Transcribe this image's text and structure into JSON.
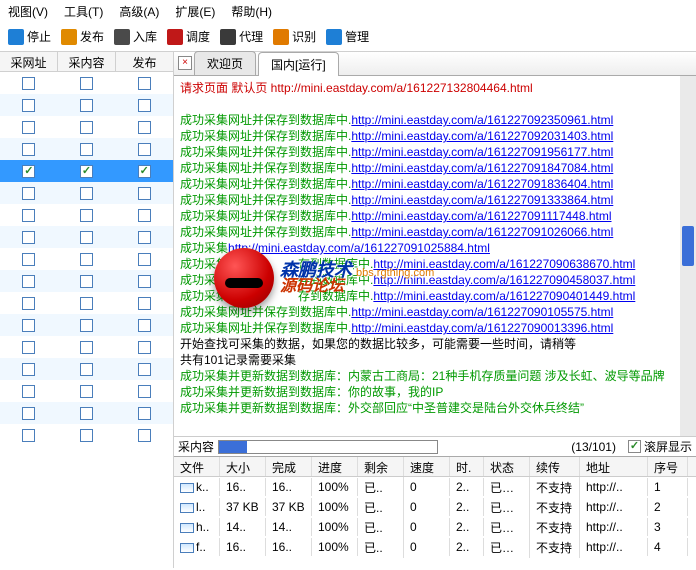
{
  "menu": [
    "视图(V)",
    "工具(T)",
    "高级(A)",
    "扩展(E)",
    "帮助(H)"
  ],
  "toolbar": [
    {
      "icon": "#1e7fd6",
      "label": "停止"
    },
    {
      "icon": "#e08a00",
      "label": "发布"
    },
    {
      "icon": "#4a4a4a",
      "label": "入库"
    },
    {
      "icon": "#c01818",
      "label": "调度"
    },
    {
      "icon": "#3a3a3a",
      "label": "代理"
    },
    {
      "icon": "#e07a00",
      "label": "识别"
    },
    {
      "icon": "#1e7fd6",
      "label": "管理"
    }
  ],
  "left_cols": [
    "采网址",
    "采内容",
    "发布"
  ],
  "rows": [
    {
      "c": [
        false,
        false,
        false
      ]
    },
    {
      "c": [
        false,
        false,
        false
      ]
    },
    {
      "c": [
        false,
        false,
        false
      ]
    },
    {
      "c": [
        false,
        false,
        false
      ]
    },
    {
      "c": [
        true,
        true,
        true
      ],
      "sel": true
    },
    {
      "c": [
        false,
        false,
        false
      ]
    },
    {
      "c": [
        false,
        false,
        false
      ]
    },
    {
      "c": [
        false,
        false,
        false
      ]
    },
    {
      "c": [
        false,
        false,
        false
      ]
    },
    {
      "c": [
        false,
        false,
        false
      ]
    },
    {
      "c": [
        false,
        false,
        false
      ]
    },
    {
      "c": [
        false,
        false,
        false
      ]
    },
    {
      "c": [
        false,
        false,
        false
      ]
    },
    {
      "c": [
        false,
        false,
        false
      ]
    },
    {
      "c": [
        false,
        false,
        false
      ]
    },
    {
      "c": [
        false,
        false,
        false
      ]
    },
    {
      "c": [
        false,
        false,
        false
      ]
    }
  ],
  "tabs": {
    "close": "×",
    "welcome": "欢迎页",
    "active": "国内[运行]"
  },
  "request_line": {
    "prefix": "请求页面 默认页 ",
    "url": "http://mini.eastday.com/a/161227132804464.html"
  },
  "success_prefix": "成功采集网址并保存到数据库中.",
  "urls": [
    "http://mini.eastday.com/a/161227092350961.html",
    "http://mini.eastday.com/a/161227092031403.html",
    "http://mini.eastday.com/a/161227091956177.html",
    "http://mini.eastday.com/a/161227091847084.html",
    "http://mini.eastday.com/a/161227091836404.html",
    "http://mini.eastday.com/a/161227091333864.html",
    "http://mini.eastday.com/a/161227091117448.html",
    "http://mini.eastday.com/a/161227091026066.html",
    "http://mini.eastday.com/a/161227091025884.html",
    "http://mini.eastday.com/a/161227090638670.html",
    "http://mini.eastday.com/a/161227090458037.html",
    "http://mini.eastday.com/a/161227090401449.html",
    "http://mini.eastday.com/a/161227090105575.html",
    "http://mini.eastday.com/a/161227090013396.html"
  ],
  "short_prefix": "成功采集",
  "mid_prefix": "存到数据库中.",
  "tail_lines": [
    "开始查找可采集的数据，如果您的数据比较多，可能需要一些时间，请稍等",
    "共有101记录需要采集"
  ],
  "update_prefix": "成功采集并更新数据到数据库：",
  "updates": [
    "内蒙古工商局：21种手机存质量问题 涉及长虹、波导等品牌",
    "你的故事，我的IP",
    "外交部回应“中圣普建交是陆台外交休兵终结”"
  ],
  "status": {
    "label": "采内容",
    "count": "(13/101)",
    "scroll": "滚屏显示"
  },
  "grid_cols": [
    "文件",
    "大小",
    "完成",
    "进度",
    "剩余",
    "速度",
    "时.",
    "状态",
    "续传",
    "地址",
    "序号"
  ],
  "grid_rows": [
    {
      "f": "k..",
      "sz": "16..",
      "cm": "16..",
      "pg": "100%",
      "rm": "已..",
      "sp": "0",
      "tm": "2..",
      "st": "已完成",
      "ct": "不支持",
      "ad": "http://..",
      "no": "1"
    },
    {
      "f": "l..",
      "sz": "37 KB",
      "cm": "37 KB",
      "pg": "100%",
      "rm": "已..",
      "sp": "0",
      "tm": "2..",
      "st": "已完成",
      "ct": "不支持",
      "ad": "http://..",
      "no": "2"
    },
    {
      "f": "h..",
      "sz": "14..",
      "cm": "14..",
      "pg": "100%",
      "rm": "已..",
      "sp": "0",
      "tm": "2..",
      "st": "已完成",
      "ct": "不支持",
      "ad": "http://..",
      "no": "3"
    },
    {
      "f": "f..",
      "sz": "16..",
      "cm": "16..",
      "pg": "100%",
      "rm": "已..",
      "sp": "0",
      "tm": "2..",
      "st": "已完成",
      "ct": "不支持",
      "ad": "http://..",
      "no": "4"
    }
  ]
}
